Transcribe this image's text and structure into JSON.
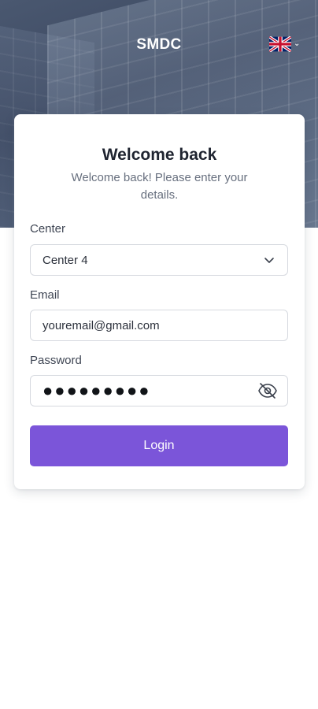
{
  "header": {
    "brand": "SMDC",
    "language_icon": "uk-flag-icon",
    "language_chevron": "chevron-down-icon"
  },
  "card": {
    "title": "Welcome back",
    "subtitle": "Welcome back! Please enter your details."
  },
  "form": {
    "center_label": "Center",
    "center_value": "Center 4",
    "email_label": "Email",
    "email_value": "youremail@gmail.com",
    "password_label": "Password",
    "password_masked": "●●●●●●●●●",
    "password_icon": "eye-off-icon",
    "login_label": "Login"
  },
  "colors": {
    "accent": "#7b55d9",
    "hero": "#3b4760"
  }
}
